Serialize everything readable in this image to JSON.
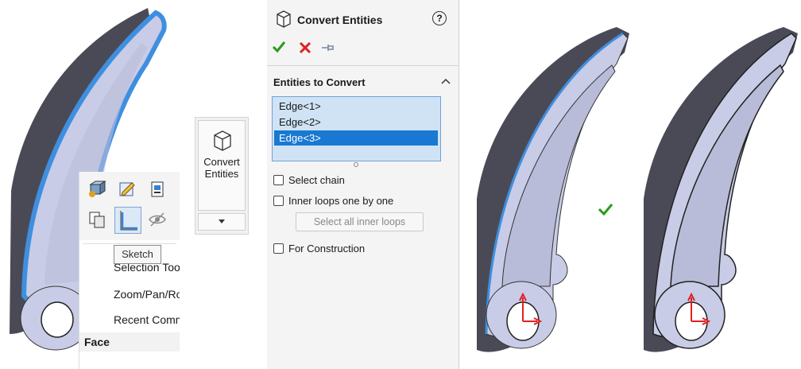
{
  "context_menu": {
    "tooltip": "Sketch",
    "items": [
      "Selection Tools",
      "Zoom/Pan/Rotate",
      "Recent Commands"
    ],
    "section_header": "Face"
  },
  "toolbar_button": {
    "label_line1": "Convert",
    "label_line2": "Entities"
  },
  "property_manager": {
    "title": "Convert Entities",
    "help_glyph": "?",
    "section_title": "Entities to Convert",
    "entities": [
      "Edge<1>",
      "Edge<2>",
      "Edge<3>"
    ],
    "selected_entity_index": 2,
    "options": {
      "select_chain": "Select chain",
      "inner_loops": "Inner loops one by one",
      "select_all_inner_loops": "Select all inner loops",
      "for_construction": "For Construction"
    },
    "colors": {
      "accept": "#2a9a1a",
      "cancel": "#e02020",
      "highlight": "#1979d2"
    }
  }
}
